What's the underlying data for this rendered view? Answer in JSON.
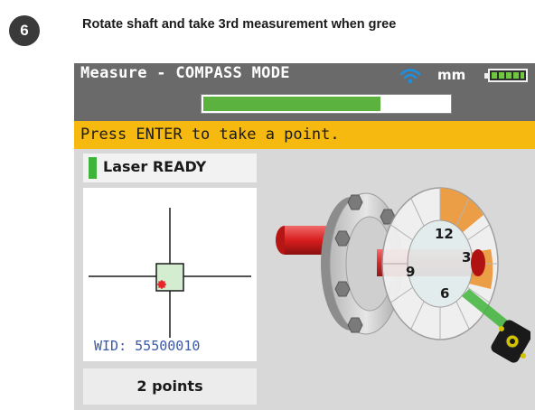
{
  "step": {
    "number": "6",
    "instruction": "Rotate shaft and take 3rd measurement when gree"
  },
  "device": {
    "title": "Measure - COMPASS MODE",
    "units": "mm",
    "icons": {
      "wifi": "wifi-icon",
      "battery": "battery-icon"
    },
    "battery_level": 1.0,
    "progress": 0.72,
    "status_message": "Press ENTER to take a point.",
    "laser_status": "Laser READY",
    "wid_label": "WID: 55500010",
    "points_count": "2 points",
    "compass_labels": [
      "12",
      "3",
      "6",
      "9"
    ]
  },
  "colors": {
    "header_bg": "#6a6a6a",
    "status_bar": "#f6b910",
    "progress_fill": "#5cb23e",
    "laser_ready": "#3fb43a",
    "wid_text": "#3a59a8",
    "compass_active_segment": "#ee9a3a"
  }
}
